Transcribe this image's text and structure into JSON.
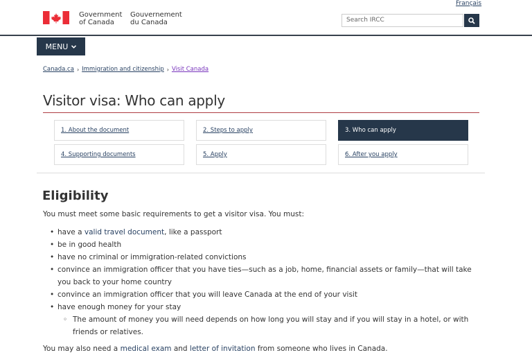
{
  "header": {
    "language_toggle": "Français",
    "signature_en_line1": "Government",
    "signature_en_line2": "of Canada",
    "signature_fr_line1": "Gouvernement",
    "signature_fr_line2": "du Canada",
    "search_placeholder": "Search IRCC",
    "menu_label": "MENU"
  },
  "breadcrumb": [
    "Canada.ca",
    "Immigration and citizenship",
    "Visit Canada"
  ],
  "page_title": "Visitor visa: Who can apply",
  "doc_nav": [
    {
      "label": "1. About the document",
      "active": false
    },
    {
      "label": "2. Steps to apply",
      "active": false
    },
    {
      "label": "3. Who can apply",
      "active": true
    },
    {
      "label": "4. Supporting documents",
      "active": false
    },
    {
      "label": "5. Apply",
      "active": false
    },
    {
      "label": "6. After you apply",
      "active": false
    }
  ],
  "section": {
    "heading": "Eligibility",
    "intro": "You must meet some basic requirements to get a visitor visa. You must:",
    "item1_pre": "have a ",
    "item1_link": "valid travel document",
    "item1_post": ", like a passport",
    "item2": "be in good health",
    "item3": "have no criminal or immigration-related convictions",
    "item4": "convince an immigration officer that you have ties—such as a job, home, financial assets or family—that will take you back to your home country",
    "item5": "convince an immigration officer that you will leave Canada at the end of your visit",
    "item6": "have enough money for your stay",
    "item6_sub": "The amount of money you will need depends on how long you will stay and if you will stay in a hotel, or with friends or relatives.",
    "outro_pre": "You may also need a ",
    "outro_link1": "medical exam",
    "outro_mid": " and ",
    "outro_link2": "letter of invitation",
    "outro_post": " from someone who lives in Canada."
  },
  "colors": {
    "brand_dark": "#26374a",
    "flag_red": "#eb2d37",
    "title_rule": "#af3c43",
    "link": "#284162"
  }
}
